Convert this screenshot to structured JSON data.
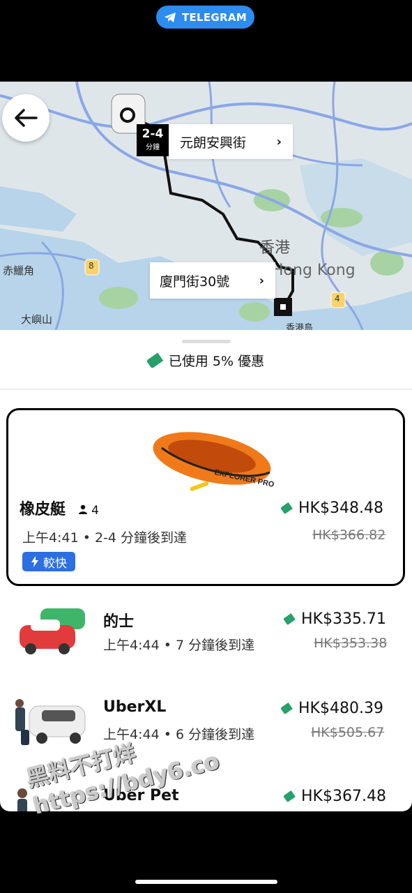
{
  "banner": {
    "label": "TELEGRAM",
    "color": "#2c8cf0"
  },
  "map": {
    "eta_number": "2-4",
    "eta_unit": "分鐘",
    "pickup": "元朗安興街",
    "dropoff": "廈門街30號",
    "labels": [
      "赤鱲角",
      "大嶼山",
      "香港",
      "Hong Kong",
      "香港島",
      "8",
      "4"
    ]
  },
  "promo": {
    "text": "已使用 5% 優惠",
    "tag_color": "#27a06a"
  },
  "options": [
    {
      "name": "橡皮艇",
      "capacity": "4",
      "time": "上午4:41 • 2-4 分鐘後到達",
      "price": "HK$348.48",
      "old_price": "HK$366.82",
      "badge": "較快",
      "selected": true
    },
    {
      "name": "的士",
      "time": "上午4:44 • 7 分鐘後到達",
      "price": "HK$335.71",
      "old_price": "HK$353.38"
    },
    {
      "name": "UberXL",
      "time": "上午4:44 • 6 分鐘後到達",
      "price": "HK$480.39",
      "old_price": "HK$505.67"
    },
    {
      "name": "Uber Pet",
      "price": "HK$367.48"
    }
  ],
  "boat_text": "EXPLORER PRO",
  "watermark": {
    "line1": "黑料不打烊",
    "line2": "https://bdy6.co"
  }
}
